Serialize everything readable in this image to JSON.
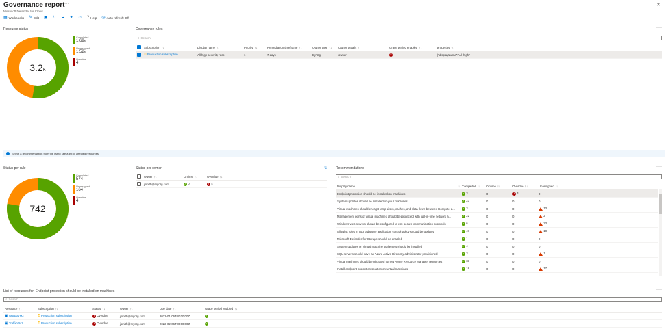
{
  "header": {
    "title": "Governance report",
    "subtitle": "Microsoft Defender for Cloud"
  },
  "toolbar": {
    "items": [
      {
        "label": "Workbooks",
        "icon": "workbook-icon"
      },
      {
        "label": "Edit",
        "icon": "edit-icon"
      },
      {
        "label": "",
        "icon": "save-icon"
      },
      {
        "label": "",
        "icon": "refresh-icon"
      },
      {
        "label": "",
        "icon": "share-icon"
      },
      {
        "label": "",
        "icon": "pin-icon"
      },
      {
        "label": "",
        "icon": "feedback-icon"
      },
      {
        "label": "Help",
        "icon": "help-icon"
      },
      {
        "label": "Auto refresh: Off",
        "icon": "auto-refresh-icon"
      }
    ]
  },
  "resource_status": {
    "title": "Resource status",
    "center": "3.2",
    "center_suffix": "K",
    "legend": [
      {
        "name": "Completed",
        "value": "1.69",
        "suffix": "K",
        "color": "#57a300"
      },
      {
        "name": "Unassigned",
        "value": "1.52",
        "suffix": "K",
        "color": "#ff8c00"
      },
      {
        "name": "Overdue",
        "value": "4",
        "suffix": "",
        "color": "#a80000"
      }
    ],
    "completed_fraction": 0.527
  },
  "governance_rules": {
    "title": "Governance rules",
    "search_placeholder": "Search",
    "columns": [
      "Subscription",
      "Display name",
      "Priority",
      "Remediation timeframe",
      "Owner type",
      "Owner details",
      "Grace period enabled",
      "properties"
    ],
    "rows": [
      {
        "subscription": "Production subscription",
        "display_name": "All high severity recs",
        "priority": "1",
        "timeframe": "7 days",
        "owner_type": "ByTag",
        "owner_details": "owner",
        "properties": "{\"displayName\":\"All high\""
      }
    ]
  },
  "info_bar": {
    "text": "Select a recommendation from the list to see a list of affected resources"
  },
  "status_per_rule": {
    "title": "Status per rule",
    "center": "742",
    "legend": [
      {
        "name": "Completed",
        "value": "574",
        "color": "#57a300"
      },
      {
        "name": "Unassigned",
        "value": "164",
        "color": "#ff8c00"
      },
      {
        "name": "Overdue",
        "value": "4",
        "color": "#a80000"
      }
    ],
    "completed_fraction": 0.774
  },
  "status_per_owner": {
    "title": "Status per owner",
    "columns": [
      "Owner",
      "Ontime",
      "Overdue"
    ],
    "rows": [
      {
        "owner": "jsmith@myorg.com",
        "ontime": "0",
        "overdue": "4"
      }
    ]
  },
  "recommendations": {
    "title": "Recommendations",
    "search_placeholder": "Search",
    "columns": [
      "Display name",
      "Completed",
      "Ontime",
      "Overdue",
      "Unassigned"
    ],
    "rows": [
      {
        "name": "Endpoint protection should be installed on machines",
        "completed": "3",
        "ontime": "0",
        "overdue": "4",
        "unassigned": "0",
        "ov": true,
        "un": false
      },
      {
        "name": "System updates should be installed on your machines",
        "completed": "23",
        "ontime": "0",
        "overdue": "0",
        "unassigned": "0",
        "ov": false,
        "un": false
      },
      {
        "name": "Virtual machines should encrypt temp disks, caches, and data flows between Compute a...",
        "completed": "3",
        "ontime": "0",
        "overdue": "0",
        "unassigned": "13",
        "ov": false,
        "un": true
      },
      {
        "name": "Management ports of virtual machines should be protected with just-in-time network a...",
        "completed": "22",
        "ontime": "0",
        "overdue": "0",
        "unassigned": "2",
        "ov": false,
        "un": true
      },
      {
        "name": "Windows web servers should be configured to use secure communication protocols",
        "completed": "6",
        "ontime": "0",
        "overdue": "0",
        "unassigned": "23",
        "ov": false,
        "un": true
      },
      {
        "name": "Allowlist rules in your adaptive application control policy should be updated",
        "completed": "47",
        "ontime": "0",
        "overdue": "0",
        "unassigned": "18",
        "ov": false,
        "un": true
      },
      {
        "name": "Microsoft Defender for Storage should be enabled",
        "completed": "1",
        "ontime": "0",
        "overdue": "0",
        "unassigned": "0",
        "ov": false,
        "un": false
      },
      {
        "name": "System updates on virtual machine scale sets should be installed",
        "completed": "4",
        "ontime": "0",
        "overdue": "0",
        "unassigned": "0",
        "ov": false,
        "un": false
      },
      {
        "name": "SQL servers should have an Azure Active Directory administrator provisioned",
        "completed": "3",
        "ontime": "0",
        "overdue": "0",
        "unassigned": "1",
        "ov": false,
        "un": true
      },
      {
        "name": "Virtual machines should be migrated to new Azure Resource Manager resources",
        "completed": "33",
        "ontime": "0",
        "overdue": "0",
        "unassigned": "0",
        "ov": false,
        "un": false
      },
      {
        "name": "Install endpoint protection solution on virtual machines",
        "completed": "18",
        "ontime": "0",
        "overdue": "0",
        "unassigned": "17",
        "ov": false,
        "un": true
      }
    ]
  },
  "resources_list": {
    "title": "List of resources for: Endpoint protection should be installed on machines",
    "search_placeholder": "Search",
    "columns": [
      "Resource",
      "Subscription",
      "Status",
      "Owner",
      "Due date",
      "Grace period enabled"
    ],
    "rows": [
      {
        "resource": "QnappVM2",
        "subscription": "Production subscription",
        "status": "Overdue",
        "owner": "jsmith@myorg.com",
        "due": "2022-01-06T00:00:00Z"
      },
      {
        "resource": "TrafficVM1",
        "subscription": "Production subscription",
        "status": "Overdue",
        "owner": "jsmith@myorg.com",
        "due": "2022-02-06T00:00:00Z"
      }
    ]
  }
}
